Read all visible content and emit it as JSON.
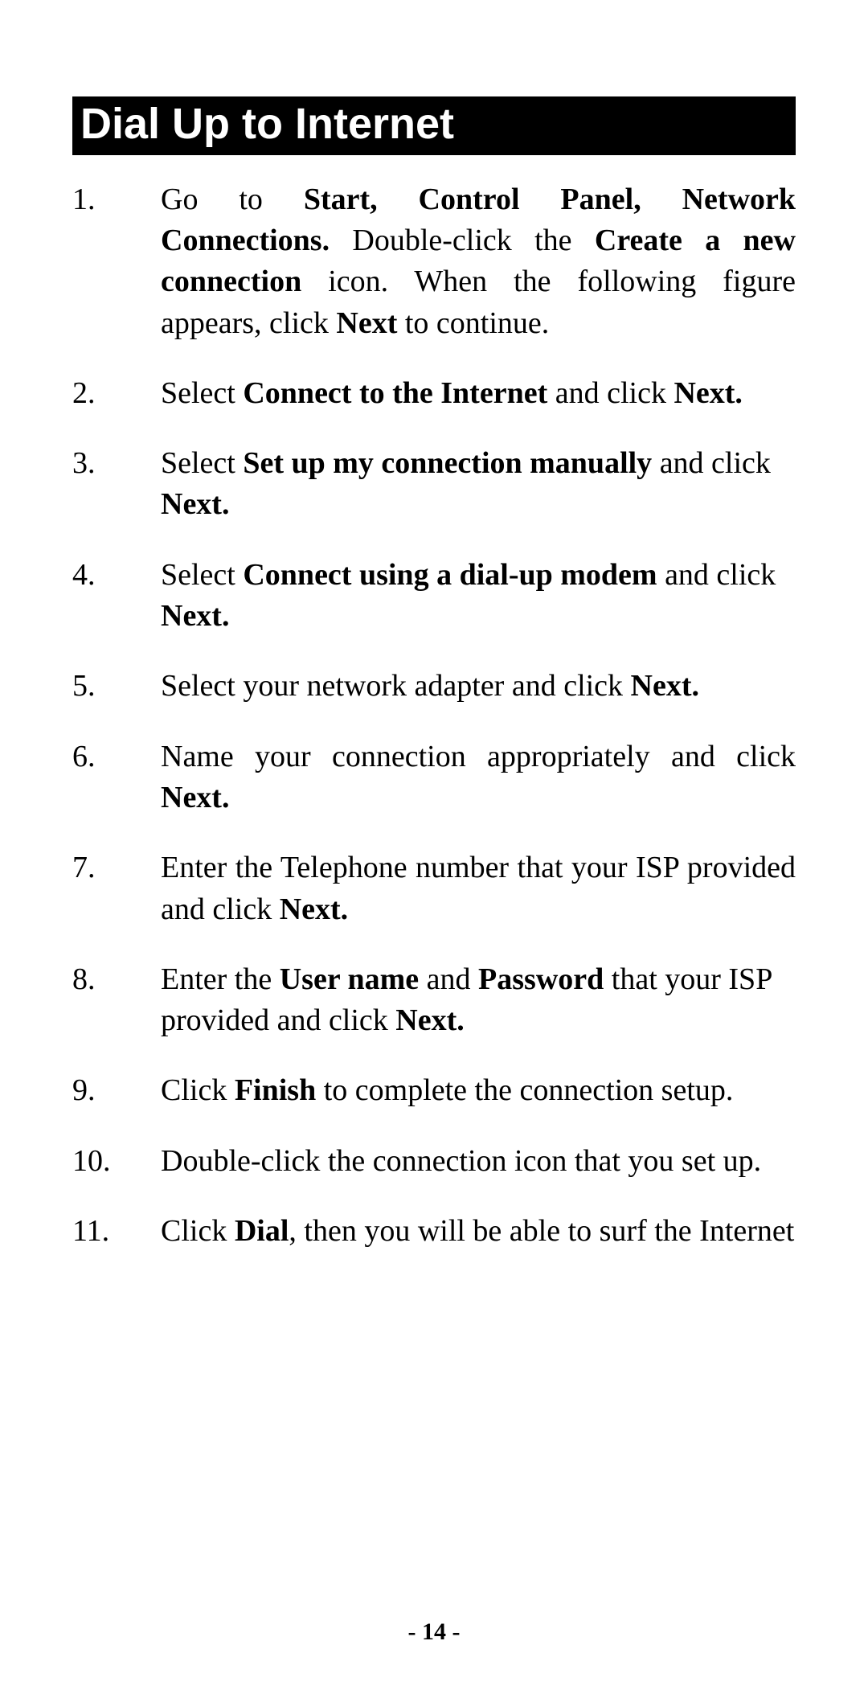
{
  "title": "Dial Up to Internet",
  "page_number": "- 14 -",
  "steps": [
    {
      "segments": [
        {
          "t": "Go to ",
          "b": false
        },
        {
          "t": "Start, Control Panel, Network Connections.",
          "b": true
        },
        {
          "t": "  Double-click the ",
          "b": false
        },
        {
          "t": "Create a new connection",
          "b": true
        },
        {
          "t": " icon.  When the following figure appears, click ",
          "b": false
        },
        {
          "t": "Next",
          "b": true
        },
        {
          "t": " to continue.",
          "b": false
        }
      ],
      "justify": true
    },
    {
      "segments": [
        {
          "t": "Select ",
          "b": false
        },
        {
          "t": "Connect to the Internet",
          "b": true
        },
        {
          "t": " and click ",
          "b": false
        },
        {
          "t": "Next.",
          "b": true
        }
      ],
      "justify": false
    },
    {
      "segments": [
        {
          "t": "Select ",
          "b": false
        },
        {
          "t": "Set up my connection manually",
          "b": true
        },
        {
          "t": " and click ",
          "b": false
        },
        {
          "t": "Next.",
          "b": true
        }
      ],
      "justify": false
    },
    {
      "segments": [
        {
          "t": "Select ",
          "b": false
        },
        {
          "t": "Connect using a dial-up modem",
          "b": true
        },
        {
          "t": " and click ",
          "b": false
        },
        {
          "t": "Next.",
          "b": true
        }
      ],
      "justify": false
    },
    {
      "segments": [
        {
          "t": "Select your network adapter and click ",
          "b": false
        },
        {
          "t": "Next.",
          "b": true
        }
      ],
      "justify": false
    },
    {
      "segments": [
        {
          "t": "Name your connection appropriately and click ",
          "b": false
        },
        {
          "t": "Next.",
          "b": true
        }
      ],
      "justify": true
    },
    {
      "segments": [
        {
          "t": "Enter the Telephone number that your ISP provided and click ",
          "b": false
        },
        {
          "t": "Next.",
          "b": true
        }
      ],
      "justify": true
    },
    {
      "segments": [
        {
          "t": "Enter the ",
          "b": false
        },
        {
          "t": "User name",
          "b": true
        },
        {
          "t": " and ",
          "b": false
        },
        {
          "t": "Password",
          "b": true
        },
        {
          "t": " that your ISP provided and click ",
          "b": false
        },
        {
          "t": "Next.",
          "b": true
        }
      ],
      "justify": false
    },
    {
      "segments": [
        {
          "t": "Click ",
          "b": false
        },
        {
          "t": "Finish",
          "b": true
        },
        {
          "t": " to complete the connection setup.",
          "b": false
        }
      ],
      "justify": true
    },
    {
      "segments": [
        {
          "t": "Double-click the connection icon that you set up.",
          "b": false
        }
      ],
      "justify": false
    },
    {
      "segments": [
        {
          "t": "Click ",
          "b": false
        },
        {
          "t": "Dial",
          "b": true
        },
        {
          "t": ", then you will be able to surf the Internet",
          "b": false
        }
      ],
      "justify": true
    }
  ]
}
